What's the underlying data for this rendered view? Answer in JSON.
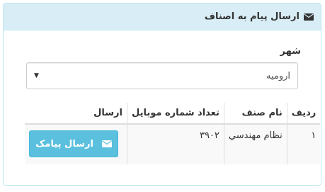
{
  "panel": {
    "title": "ارسال پیام به اصناف",
    "title_icon": "envelope-icon"
  },
  "city": {
    "label": "شهر",
    "selected": "ارومیه"
  },
  "table": {
    "headers": [
      "ردیف",
      "نام صنف",
      "تعداد شماره موبایل",
      "ارسال"
    ],
    "rows": [
      {
        "index": "۱",
        "guild": "نظام مهندسي",
        "mobile_count": "۳۹۰۲",
        "send_label": "ارسال پیامک"
      }
    ]
  },
  "colors": {
    "heading_bg": "#d9edf7",
    "button_bg": "#5bc0de"
  }
}
